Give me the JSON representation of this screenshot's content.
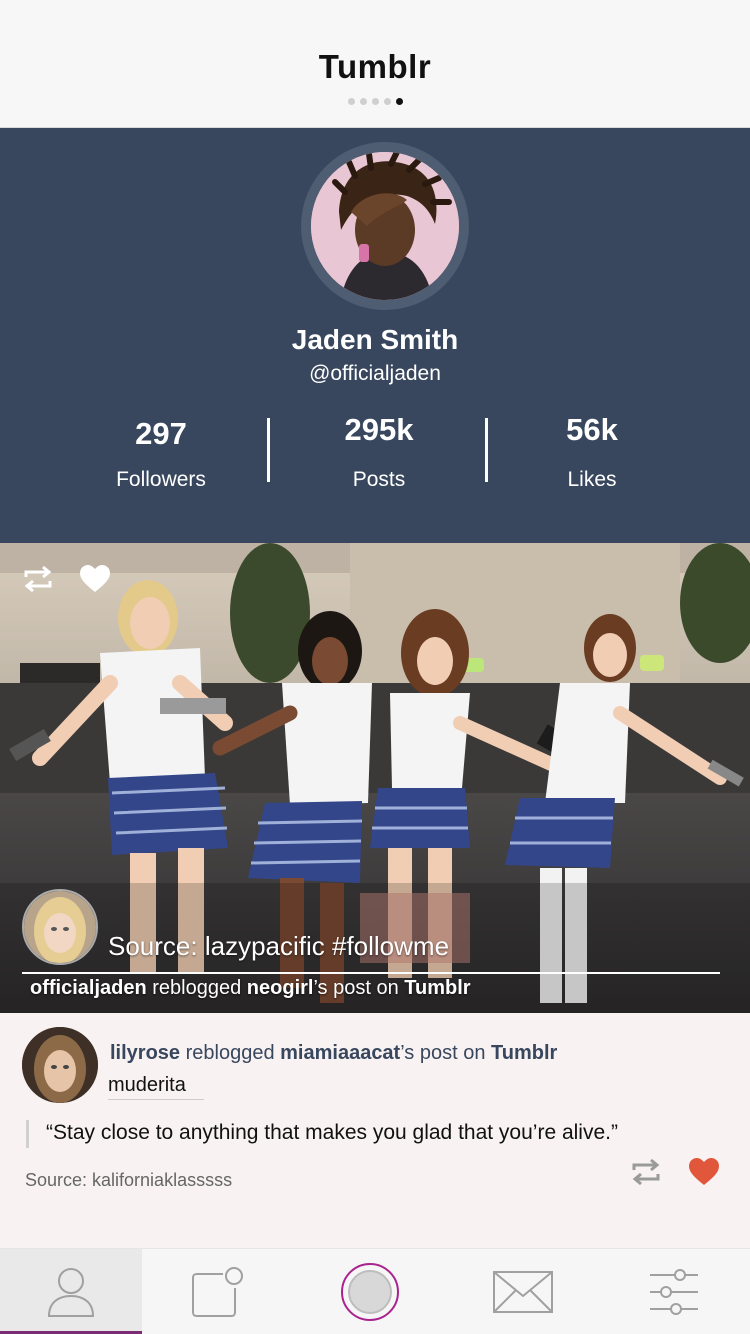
{
  "header": {
    "title": "Tumblr",
    "page_count": 5,
    "active_page": 5
  },
  "profile": {
    "name": "Jaden Smith",
    "handle": "@officialjaden",
    "stats": [
      {
        "value": "297",
        "label": "Followers"
      },
      {
        "value": "295k",
        "label": "Posts"
      },
      {
        "value": "56k",
        "label": "Likes"
      }
    ]
  },
  "photo_post": {
    "icons": [
      "reblog-icon",
      "heart-icon"
    ],
    "source_text": "Source: lazypacific #followme",
    "caption": {
      "user": "officialjaden",
      "reblogged_text": "reblogged",
      "original_user": "neogirl",
      "post_on_text": "’s post on",
      "platform": "Tumblr"
    }
  },
  "text_post": {
    "user": "lilyrose",
    "reblogged_text": "reblogged",
    "original_user": "miamiaaacat",
    "post_on_text": "’s post on",
    "platform": "Tumblr",
    "tag": "muderita",
    "quote": "“Stay close to anything that makes you glad that you’re alive.”",
    "source": "Source: kaliforniaklasssss",
    "icons": [
      "reblog-icon",
      "heart-icon"
    ],
    "heart_color": "#e0573b"
  },
  "tabbar": {
    "tabs": [
      "profile-icon",
      "new-post-icon",
      "home-icon",
      "mail-icon",
      "settings-sliders-icon"
    ],
    "active_tab": 0,
    "accent": "#7b2d73"
  },
  "colors": {
    "profile_bg": "#38475e",
    "header_bg": "#f7f7f7",
    "link_text": "#38475e"
  }
}
